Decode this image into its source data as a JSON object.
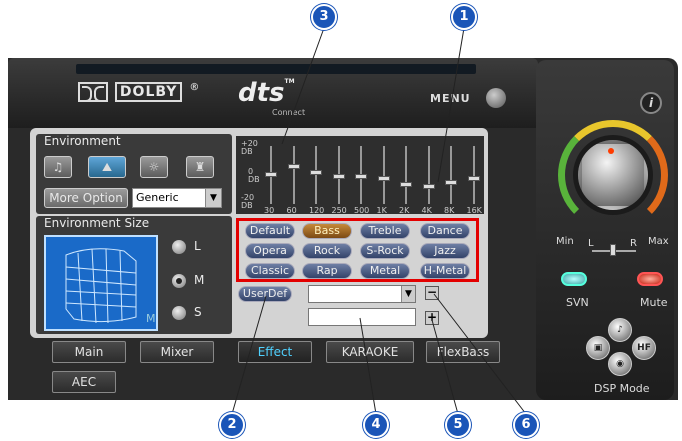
{
  "header": {
    "dolby_label": "DOLBY",
    "registered": "®",
    "dts_label": "dts",
    "dts_tm": "TM",
    "dts_sub": "Connect",
    "menu_label": "MENU",
    "info_label": "i"
  },
  "environment": {
    "title": "Environment",
    "more_option_label": "More Option",
    "preset_value": "Generic",
    "size_title": "Environment Size",
    "room_size_marker": "M",
    "sizes": [
      "L",
      "M",
      "S"
    ],
    "selected_size": "M"
  },
  "equalizer": {
    "db_labels": [
      "+20",
      "DB",
      "0",
      "DB",
      "-20",
      "DB"
    ],
    "freq_labels": [
      "30",
      "60",
      "120",
      "250",
      "500",
      "1K",
      "2K",
      "4K",
      "8K",
      "16K"
    ],
    "presets": [
      "Default",
      "Bass",
      "Treble",
      "Dance",
      "Opera",
      "Rock",
      "S-Rock",
      "Jazz",
      "Classic",
      "Rap",
      "Metal",
      "H-Metal"
    ],
    "selected_preset": "Bass",
    "userdef_label": "UserDef",
    "minus_label": "−",
    "plus_label": "+"
  },
  "tabs": {
    "main": "Main",
    "mixer": "Mixer",
    "effect": "Effect",
    "karaoke": "KARAOKE",
    "flexbass": "FlexBass",
    "aec": "AEC",
    "active": "Effect"
  },
  "side": {
    "min_label": "Min",
    "max_label": "Max",
    "l_label": "L",
    "r_label": "R",
    "svn_label": "SVN",
    "mute_label": "Mute",
    "dsp_mode_label": "DSP Mode",
    "hf_label": "HF"
  },
  "callouts": [
    "1",
    "2",
    "3",
    "4",
    "5",
    "6"
  ]
}
